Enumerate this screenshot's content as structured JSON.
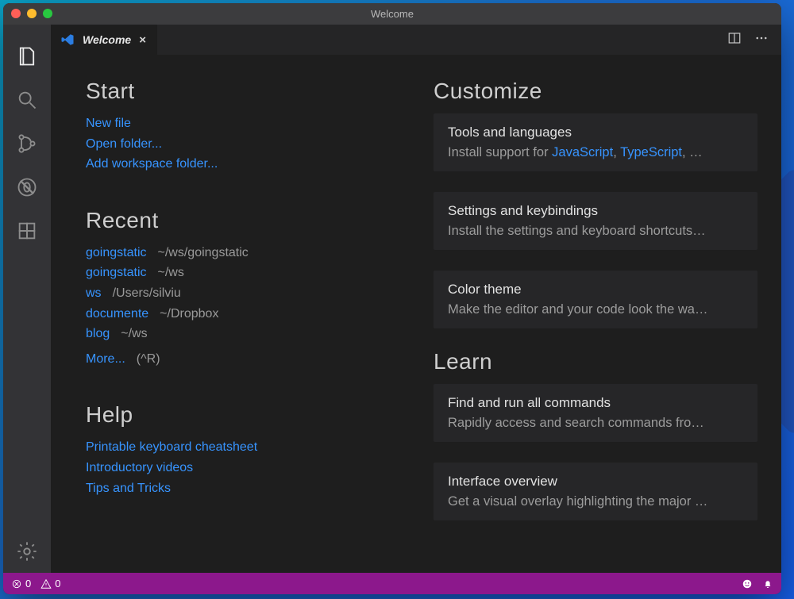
{
  "window": {
    "title": "Welcome"
  },
  "tab": {
    "label": "Welcome"
  },
  "headings": {
    "start": "Start",
    "recent": "Recent",
    "help": "Help",
    "customize": "Customize",
    "learn": "Learn"
  },
  "start": {
    "new_file": "New file",
    "open_folder": "Open folder...",
    "add_workspace": "Add workspace folder..."
  },
  "recent": {
    "items": [
      {
        "name": "goingstatic",
        "path": "~/ws/goingstatic"
      },
      {
        "name": "goingstatic",
        "path": "~/ws"
      },
      {
        "name": "ws",
        "path": "/Users/silviu"
      },
      {
        "name": "documente",
        "path": "~/Dropbox"
      },
      {
        "name": "blog",
        "path": "~/ws"
      }
    ],
    "more_label": "More...",
    "more_shortcut": "(^R)"
  },
  "help": {
    "items": [
      "Printable keyboard cheatsheet",
      "Introductory videos",
      "Tips and Tricks"
    ]
  },
  "customize": {
    "tools": {
      "title": "Tools and languages",
      "desc_prefix": "Install support for ",
      "lang1": "JavaScript",
      "sep": ", ",
      "lang2": "TypeScript",
      "desc_suffix": ", …"
    },
    "settings": {
      "title": "Settings and keybindings",
      "desc": "Install the settings and keyboard shortcuts…"
    },
    "theme": {
      "title": "Color theme",
      "desc": "Make the editor and your code look the wa…"
    }
  },
  "learn": {
    "commands": {
      "title": "Find and run all commands",
      "desc": "Rapidly access and search commands fro…"
    },
    "overview": {
      "title": "Interface overview",
      "desc": "Get a visual overlay highlighting the major …"
    }
  },
  "status": {
    "errors": "0",
    "warnings": "0"
  }
}
